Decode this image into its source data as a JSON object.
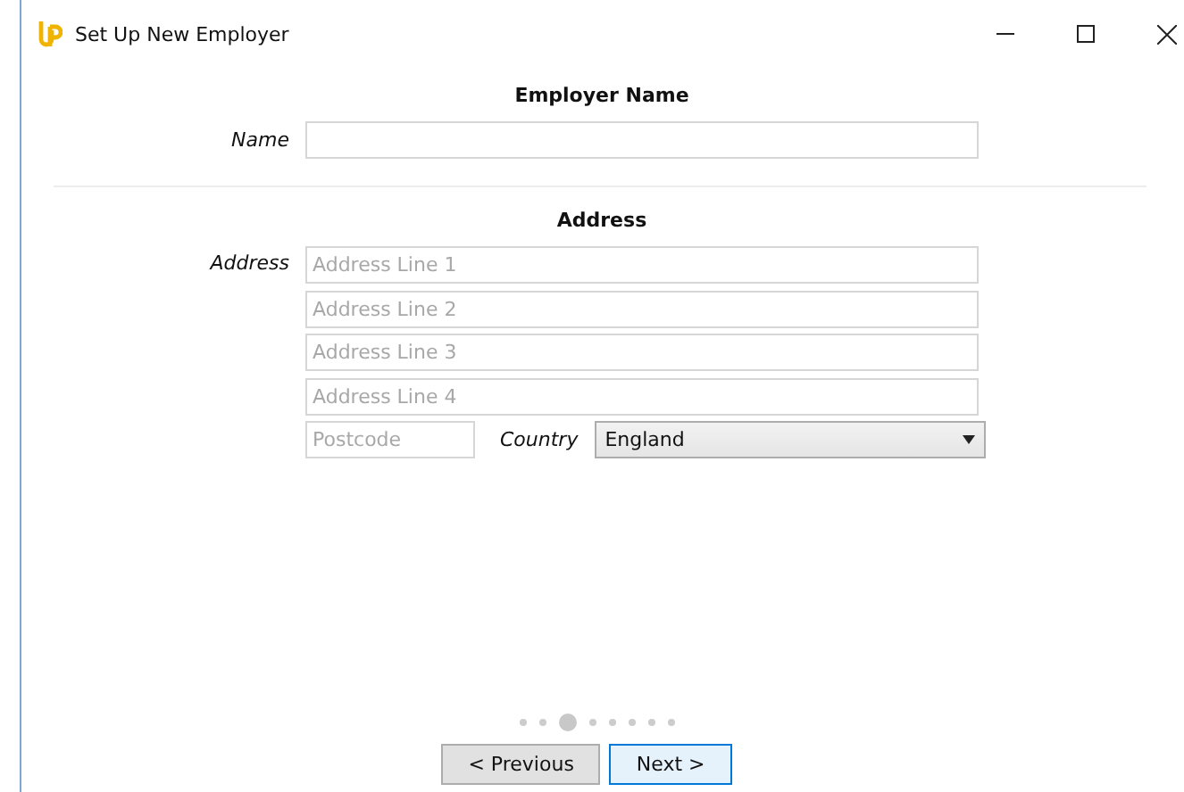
{
  "window": {
    "title": "Set Up New Employer"
  },
  "employer_section": {
    "heading": "Employer Name",
    "name_label": "Name"
  },
  "address_section": {
    "heading": "Address",
    "label": "Address",
    "lines": [
      {
        "placeholder": "Address Line 1"
      },
      {
        "placeholder": "Address Line 2"
      },
      {
        "placeholder": "Address Line 3"
      },
      {
        "placeholder": "Address Line 4"
      }
    ],
    "postcode": {
      "placeholder": "Postcode"
    },
    "country_label": "Country",
    "country_value": "England"
  },
  "pager": [
    {
      "selected": false
    },
    {
      "selected": false
    },
    {
      "selected": true
    },
    {
      "selected": false
    },
    {
      "selected": false
    },
    {
      "selected": false
    },
    {
      "selected": false
    },
    {
      "selected": false
    }
  ],
  "buttons": [
    {
      "label": "< Previous",
      "focused": false
    },
    {
      "label": "Next >",
      "focused": true
    }
  ]
}
